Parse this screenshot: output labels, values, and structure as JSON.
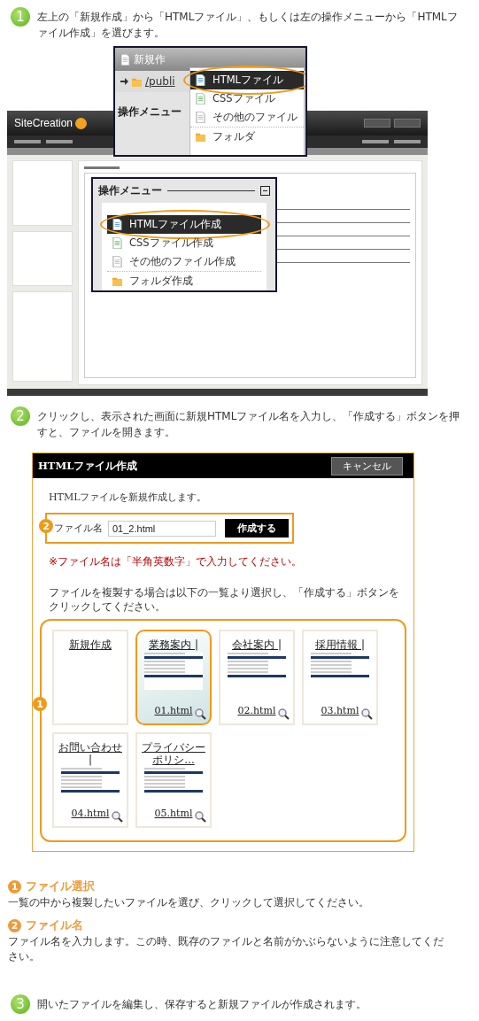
{
  "step_1": {
    "number": "1",
    "text": "左上の「新規作成」から「HTMLファイル」、もしくは左の操作メニューから「HTMLファイル作成」を選びます。"
  },
  "app_screenshot": {
    "logo": "SiteCreation",
    "new_menu": {
      "toolbar_label": "新規作",
      "path": "/publi",
      "behind_heading": "操作メニュー",
      "items": [
        {
          "kind": "html",
          "label": "HTMLファイル",
          "selected": true
        },
        {
          "kind": "css",
          "label": "CSSファイル",
          "selected": false
        },
        {
          "kind": "file",
          "label": "その他のファイル",
          "selected": false
        },
        {
          "kind": "folder",
          "label": "フォルダ",
          "selected": false
        }
      ]
    },
    "side_menu": {
      "title": "操作メニュー",
      "items": [
        {
          "kind": "html",
          "label": "HTMLファイル作成",
          "selected": true
        },
        {
          "kind": "css",
          "label": "CSSファイル作成",
          "selected": false
        },
        {
          "kind": "file",
          "label": "その他のファイル作成",
          "selected": false
        },
        {
          "kind": "folder",
          "label": "フォルダ作成",
          "selected": false
        }
      ]
    }
  },
  "step_2": {
    "number": "2",
    "text": "クリックし、表示された画面に新規HTMLファイル名を入力し、「作成する」ボタンを押すと、ファイルを開きます。"
  },
  "dialog": {
    "title": "HTMLファイル作成",
    "cancel": "キャンセル",
    "intro": "HTMLファイルを新規作成します。",
    "field_marker": "2",
    "field_label": "ファイル名",
    "field_value": "01_2.html",
    "create": "作成する",
    "warning": "※ファイル名は「半角英数字」で入力してください。",
    "copy_hint": "ファイルを複製する場合は以下の一覧より選択し、「作成する」ボタンをクリックしてください。",
    "list_marker": "1",
    "templates": [
      {
        "kind": "blank",
        "title": "新規作成",
        "selected": false
      },
      {
        "kind": "page",
        "title": "業務案内 |",
        "file": "01.html",
        "selected": true
      },
      {
        "kind": "page",
        "title": "会社案内 |",
        "file": "02.html",
        "selected": false
      },
      {
        "kind": "page",
        "title": "採用情報 |",
        "file": "03.html",
        "selected": false
      },
      {
        "kind": "page",
        "title": "お問い合わせ |",
        "file": "04.html",
        "selected": false
      },
      {
        "kind": "page",
        "title": "プライバシーポリシ...",
        "file": "05.html",
        "selected": false
      }
    ]
  },
  "notes": [
    {
      "number": "1",
      "title": "ファイル選択",
      "text": "一覧の中から複製したいファイルを選び、クリックして選択してください。"
    },
    {
      "number": "2",
      "title": "ファイル名",
      "text": "ファイル名を入力します。この時、既存のファイルと名前がかぶらないように注意してください。"
    }
  ],
  "step_3": {
    "number": "3",
    "text": "開いたファイルを編集し、保存すると新規ファイルが作成されます。"
  }
}
